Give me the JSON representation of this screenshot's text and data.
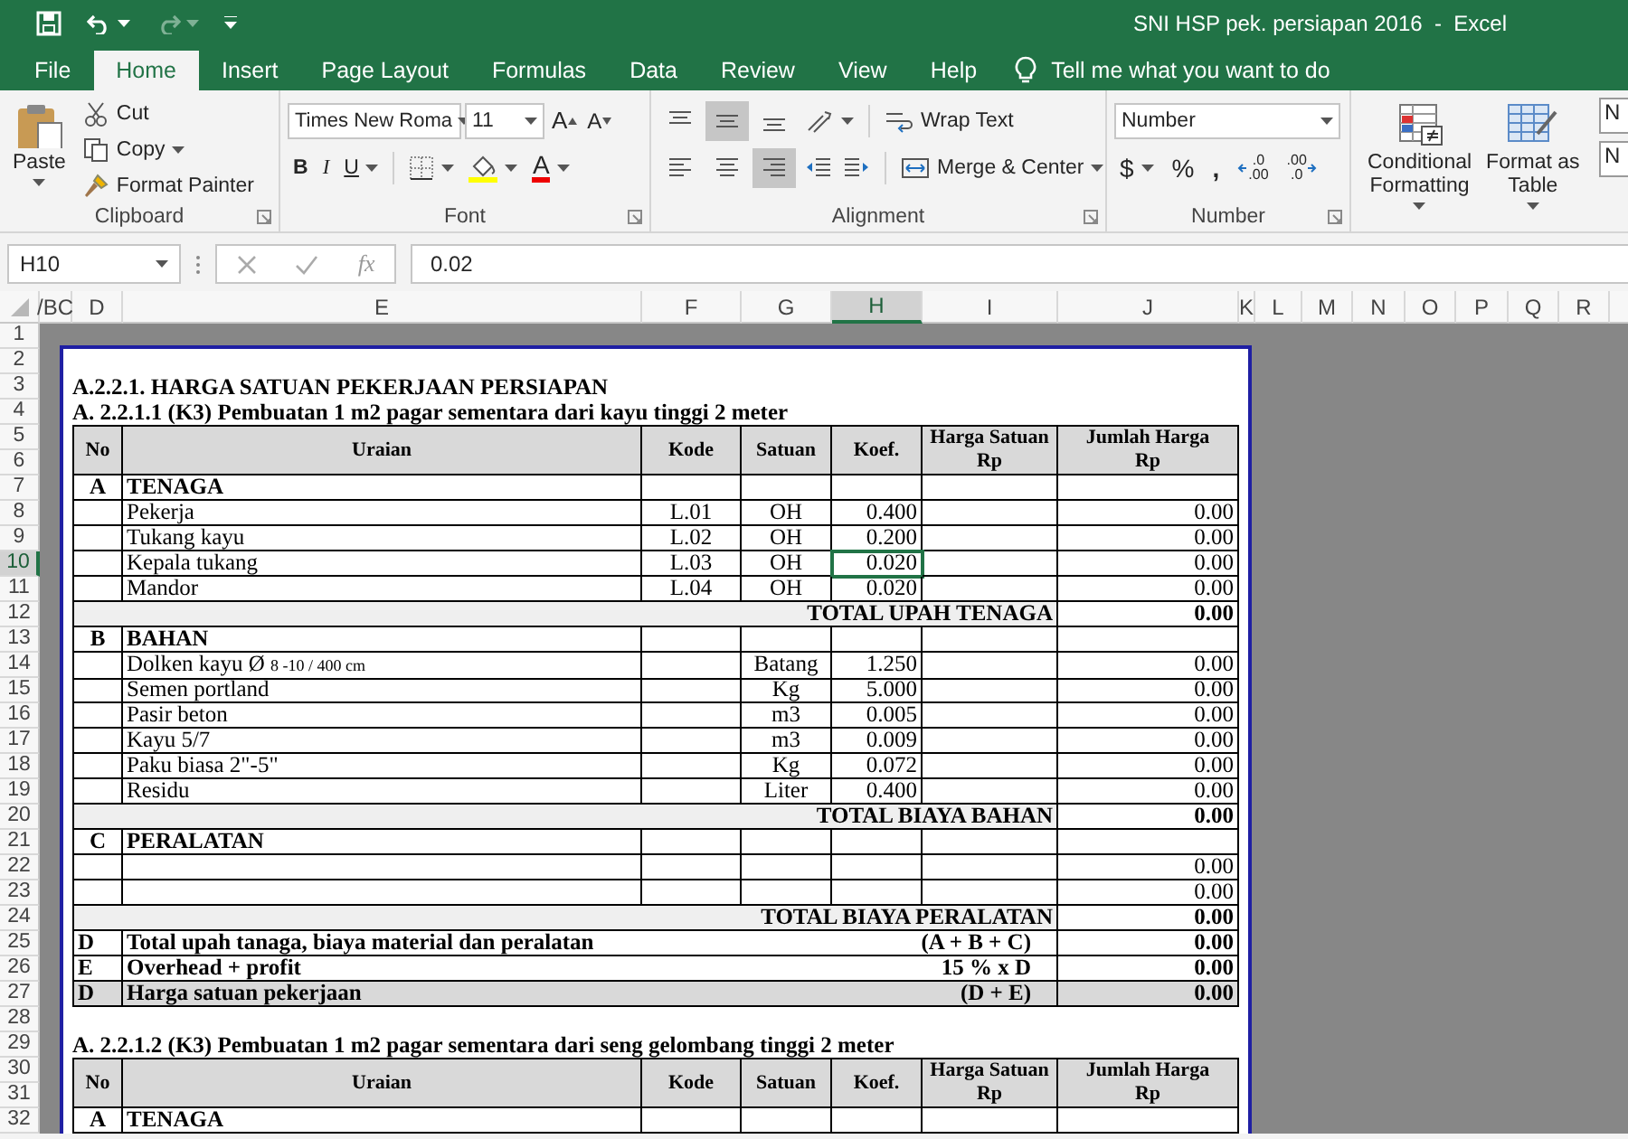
{
  "window": {
    "title": "SNI HSP pek. persiapan 2016  -  Excel"
  },
  "ribbon_tabs": [
    {
      "label": "File",
      "selected": false
    },
    {
      "label": "Home",
      "selected": true
    },
    {
      "label": "Insert",
      "selected": false
    },
    {
      "label": "Page Layout",
      "selected": false
    },
    {
      "label": "Formulas",
      "selected": false
    },
    {
      "label": "Data",
      "selected": false
    },
    {
      "label": "Review",
      "selected": false
    },
    {
      "label": "View",
      "selected": false
    },
    {
      "label": "Help",
      "selected": false
    }
  ],
  "tell_me": "Tell me what you want to do",
  "clipboard": {
    "paste": "Paste",
    "cut": "Cut",
    "copy": "Copy",
    "format_painter": "Format Painter",
    "label": "Clipboard"
  },
  "font": {
    "name": "Times New Roma",
    "size": "11",
    "grow": "A",
    "shrink": "A",
    "bold": "B",
    "italic": "I",
    "underline": "U",
    "font_color_label": "A",
    "label": "Font"
  },
  "alignment": {
    "vertical": [
      {
        "selected": false
      },
      {
        "selected": true
      },
      {
        "selected": false
      }
    ],
    "horizontal": [
      {
        "selected": false
      },
      {
        "selected": false
      },
      {
        "selected": true
      }
    ],
    "wrap_text": "Wrap Text",
    "merge_center": "Merge & Center",
    "label": "Alignment"
  },
  "number": {
    "format": "Number",
    "currency": "$",
    "percent": "%",
    "comma": ",",
    "increase_decimal": [
      ".0",
      ".00"
    ],
    "decrease_decimal": [
      ".00",
      ".0"
    ],
    "label": "Number"
  },
  "styles": {
    "conditional_formatting": [
      "Conditional",
      "Formatting"
    ],
    "format_as_table": [
      "Format as",
      "Table"
    ],
    "cell_styles": [
      "N",
      "N"
    ]
  },
  "formula_bar": {
    "name_box": "H10",
    "function_label": "fx",
    "value": "0.02"
  },
  "column_headers": [
    {
      "label": "/BC",
      "selected": false
    },
    {
      "label": "D",
      "selected": false
    },
    {
      "label": "E",
      "selected": false
    },
    {
      "label": "F",
      "selected": false
    },
    {
      "label": "G",
      "selected": false
    },
    {
      "label": "H",
      "selected": true
    },
    {
      "label": "I",
      "selected": false
    },
    {
      "label": "J",
      "selected": false
    },
    {
      "label": "K",
      "selected": false
    },
    {
      "label": "L",
      "selected": false
    },
    {
      "label": "M",
      "selected": false
    },
    {
      "label": "N",
      "selected": false
    },
    {
      "label": "O",
      "selected": false
    },
    {
      "label": "P",
      "selected": false
    },
    {
      "label": "Q",
      "selected": false
    },
    {
      "label": "R",
      "selected": false
    }
  ],
  "row_headers": [
    {
      "label": "1",
      "selected": false
    },
    {
      "label": "2",
      "selected": false
    },
    {
      "label": "3",
      "selected": false
    },
    {
      "label": "4",
      "selected": false
    },
    {
      "label": "5",
      "selected": false
    },
    {
      "label": "6",
      "selected": false
    },
    {
      "label": "7",
      "selected": false
    },
    {
      "label": "8",
      "selected": false
    },
    {
      "label": "9",
      "selected": false
    },
    {
      "label": "10",
      "selected": true
    },
    {
      "label": "11",
      "selected": false
    },
    {
      "label": "12",
      "selected": false
    },
    {
      "label": "13",
      "selected": false
    },
    {
      "label": "14",
      "selected": false
    },
    {
      "label": "15",
      "selected": false
    },
    {
      "label": "16",
      "selected": false
    },
    {
      "label": "17",
      "selected": false
    },
    {
      "label": "18",
      "selected": false
    },
    {
      "label": "19",
      "selected": false
    },
    {
      "label": "20",
      "selected": false
    },
    {
      "label": "21",
      "selected": false
    },
    {
      "label": "22",
      "selected": false
    },
    {
      "label": "23",
      "selected": false
    },
    {
      "label": "24",
      "selected": false
    },
    {
      "label": "25",
      "selected": false
    },
    {
      "label": "26",
      "selected": false
    },
    {
      "label": "27",
      "selected": false
    },
    {
      "label": "28",
      "selected": false
    },
    {
      "label": "29",
      "selected": false
    },
    {
      "label": "30",
      "selected": false
    },
    {
      "label": "31",
      "selected": false
    },
    {
      "label": "32",
      "selected": false
    }
  ],
  "sheet": {
    "lines": [
      {
        "kind": "blank"
      },
      {
        "kind": "heading",
        "text": "A.2.2.1. HARGA SATUAN PEKERJAAN PERSIAPAN"
      },
      {
        "kind": "heading",
        "text": "A. 2.2.1.1 (K3) Pembuatan 1 m2 pagar sementara dari kayu tinggi 2 meter"
      },
      {
        "kind": "header",
        "no": "No",
        "uraian": "Uraian",
        "kode": "Kode",
        "satuan": "Satuan",
        "koef": "Koef.",
        "harga_satuan": [
          "Harga Satuan",
          "Rp"
        ],
        "jumlah_harga": [
          "Jumlah Harga",
          "Rp"
        ]
      },
      {
        "kind": "section",
        "no": "A",
        "name": "TENAGA"
      },
      {
        "kind": "item",
        "uraian": "Pekerja",
        "kode": "L.01",
        "satuan": "OH",
        "koef": "0.400",
        "jumlah": "0.00",
        "selected": false
      },
      {
        "kind": "item",
        "uraian": "Tukang kayu",
        "kode": "L.02",
        "satuan": "OH",
        "koef": "0.200",
        "jumlah": "0.00",
        "selected": false
      },
      {
        "kind": "item",
        "uraian": "Kepala tukang",
        "kode": "L.03",
        "satuan": "OH",
        "koef": "0.020",
        "jumlah": "0.00",
        "selected": true
      },
      {
        "kind": "item",
        "uraian": "Mandor",
        "kode": "L.04",
        "satuan": "OH",
        "koef": "0.020",
        "jumlah": "0.00",
        "selected": false
      },
      {
        "kind": "total",
        "label": "TOTAL UPAH TENAGA",
        "amount": "0.00"
      },
      {
        "kind": "section",
        "no": "B",
        "name": "BAHAN"
      },
      {
        "kind": "item",
        "uraian": "Dolken kayu Ø",
        "note": "8 -10 / 400 cm",
        "satuan": "Batang",
        "koef": "1.250",
        "jumlah": "0.00",
        "selected": false
      },
      {
        "kind": "item",
        "uraian": "Semen portland",
        "satuan": "Kg",
        "koef": "5.000",
        "jumlah": "0.00",
        "selected": false
      },
      {
        "kind": "item",
        "uraian": "Pasir beton",
        "satuan": "m3",
        "koef": "0.005",
        "jumlah": "0.00",
        "selected": false
      },
      {
        "kind": "item",
        "uraian": "Kayu 5/7",
        "satuan": "m3",
        "koef": "0.009",
        "jumlah": "0.00",
        "selected": false
      },
      {
        "kind": "item",
        "uraian": "Paku biasa 2\"-5\"",
        "satuan": "Kg",
        "koef": "0.072",
        "jumlah": "0.00",
        "selected": false
      },
      {
        "kind": "item",
        "uraian": "Residu",
        "satuan": "Liter",
        "koef": "0.400",
        "jumlah": "0.00",
        "selected": false
      },
      {
        "kind": "total",
        "label": "TOTAL BIAYA BAHAN",
        "amount": "0.00"
      },
      {
        "kind": "section",
        "no": "C",
        "name": "PERALATAN"
      },
      {
        "kind": "item",
        "jumlah": "0.00",
        "selected": false
      },
      {
        "kind": "item",
        "jumlah": "0.00",
        "selected": false
      },
      {
        "kind": "total",
        "label": "TOTAL BIAYA PERALATAN",
        "amount": "0.00"
      },
      {
        "kind": "summary",
        "no": "D",
        "label": "Total upah tanaga, biaya material dan peralatan",
        "formula": "(A + B + C)",
        "amount": "0.00",
        "shaded": false
      },
      {
        "kind": "summary",
        "no": "E",
        "label": "Overhead + profit",
        "formula": "15 % x D",
        "amount": "0.00",
        "shaded": false
      },
      {
        "kind": "summary",
        "no": "D",
        "label": "Harga satuan pekerjaan",
        "formula": "(D + E)",
        "amount": "0.00",
        "shaded": true
      },
      {
        "kind": "blank"
      },
      {
        "kind": "heading",
        "text": "A. 2.2.1.2 (K3) Pembuatan 1 m2 pagar sementara dari seng gelombang tinggi 2 meter"
      },
      {
        "kind": "header",
        "no": "No",
        "uraian": "Uraian",
        "kode": "Kode",
        "satuan": "Satuan",
        "koef": "Koef.",
        "harga_satuan": [
          "Harga Satuan",
          "Rp"
        ],
        "jumlah_harga": [
          "Jumlah Harga",
          "Rp"
        ]
      },
      {
        "kind": "section",
        "no": "A",
        "name": "TENAGA"
      }
    ]
  }
}
